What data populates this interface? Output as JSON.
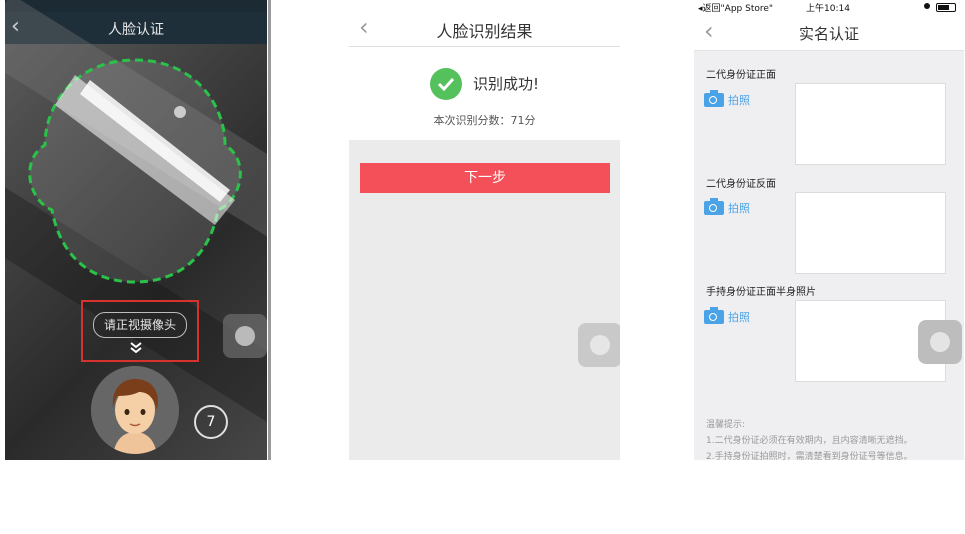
{
  "face_capture": {
    "title": "人脸认证",
    "back_icon": "‹",
    "hint": "请正视摄像头",
    "chevron_icon": "»",
    "countdown": "7",
    "oval_color": "#2bc24a"
  },
  "result": {
    "title": "人脸识别结果",
    "back_icon": "‹",
    "success_text": "识别成功!",
    "score_text": "本次识别分数：71分",
    "next_button": "下一步"
  },
  "realname": {
    "status_back_app": "◂返回\"App Store\"",
    "status_time": "上午10:14",
    "title": "实名认证",
    "back_icon": "‹",
    "sections": [
      {
        "label": "二代身份证正面",
        "shoot": "拍照"
      },
      {
        "label": "二代身份证反面",
        "shoot": "拍照"
      },
      {
        "label": "手持身份证正面半身照片",
        "shoot": "拍照"
      }
    ],
    "tips": {
      "title": "温馨提示:",
      "line1": "1.二代身份证必须在有效期内，且内容清晰无遮挡。",
      "line2": "2.手持身份证拍照时，需清楚看到身份证号等信息。"
    }
  }
}
